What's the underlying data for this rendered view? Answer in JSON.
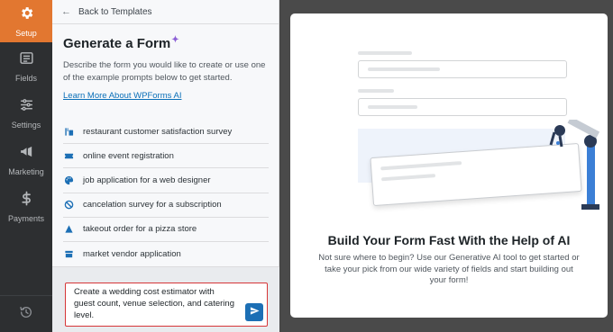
{
  "nav": {
    "items": [
      {
        "label": "Setup",
        "icon": "gear-icon",
        "active": true
      },
      {
        "label": "Fields",
        "icon": "fields-list-icon",
        "active": false
      },
      {
        "label": "Settings",
        "icon": "sliders-icon",
        "active": false
      },
      {
        "label": "Marketing",
        "icon": "megaphone-icon",
        "active": false
      },
      {
        "label": "Payments",
        "icon": "dollar-icon",
        "active": false
      }
    ],
    "history_icon": "history-icon"
  },
  "panel": {
    "back_label": "Back to Templates",
    "title": "Generate a Form",
    "description": "Describe the form you would like to create or use one of the example prompts below to get started.",
    "learn_more": "Learn More About WPForms AI",
    "prompts": [
      {
        "label": "restaurant customer satisfaction survey",
        "icon": "utensils-icon"
      },
      {
        "label": "online event registration",
        "icon": "ticket-icon"
      },
      {
        "label": "job application for a web designer",
        "icon": "palette-icon"
      },
      {
        "label": "cancelation survey for a subscription",
        "icon": "ban-icon"
      },
      {
        "label": "takeout order for a pizza store",
        "icon": "pizza-icon"
      },
      {
        "label": "market vendor application",
        "icon": "store-icon"
      }
    ],
    "input_value": "Create a wedding cost estimator with guest count, venue selection, and catering level."
  },
  "preview": {
    "title": "Build Your Form Fast With the Help of AI",
    "subtitle": "Not sure where to begin? Use our Generative AI tool to get started or take your pick from our wide variety of fields and start building out your form!"
  },
  "colors": {
    "accent": "#e27730",
    "nav_bg": "#2d2f31",
    "link": "#0a6fb8",
    "send_button": "#1c6fb5",
    "input_border": "#d63638"
  }
}
